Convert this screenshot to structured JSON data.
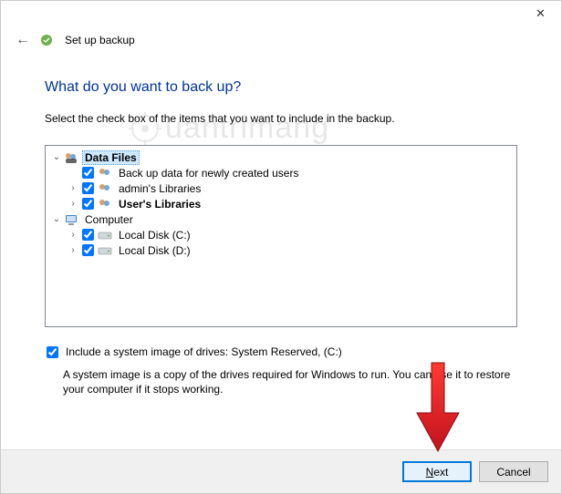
{
  "window": {
    "title": "Set up backup"
  },
  "page": {
    "heading": "What do you want to back up?",
    "instruction": "Select the check box of the items that you want to include in the backup."
  },
  "tree": {
    "dataFiles": {
      "label": "Data Files",
      "newUsers": "Back up data for newly created users",
      "adminLib": "admin's Libraries",
      "userLib": "User's Libraries"
    },
    "computer": {
      "label": "Computer",
      "localC": "Local Disk (C:)",
      "localD": "Local Disk (D:)"
    }
  },
  "sysimage": {
    "label": "Include a system image of drives: System Reserved, (C:)",
    "desc": "A system image is a copy of the drives required for Windows to run. You can use it to restore your computer if it stops working."
  },
  "buttons": {
    "next": "Next",
    "cancel": "Cancel"
  },
  "watermark": "uantrimang"
}
